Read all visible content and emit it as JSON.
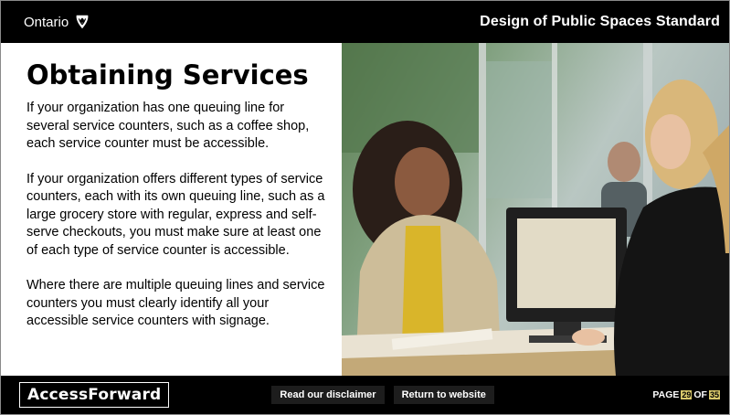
{
  "header": {
    "brand": "Ontario",
    "title": "Design of Public Spaces Standard"
  },
  "content": {
    "heading": "Obtaining Services",
    "paragraphs": [
      "If your organization has one queuing line for several service counters, such as a coffee shop, each service counter must be accessible.",
      "If your organization offers different types of service counters, each with its own queuing line, such as a large grocery store with regular, express and self-serve checkouts, you must make sure at least one of each type of service counter is accessible.",
      "Where there are multiple queuing lines and service counters you must clearly identify all your accessible service counters with signage."
    ]
  },
  "footer": {
    "logo": "AccessForward",
    "disclaimer_label": "Read our disclaimer",
    "return_label": "Return to website",
    "page_prefix": "PAGE",
    "current_page": "29",
    "page_of": "OF",
    "total_pages": "35"
  },
  "colors": {
    "bar": "#000000",
    "page_badge": "#d8c76a"
  }
}
